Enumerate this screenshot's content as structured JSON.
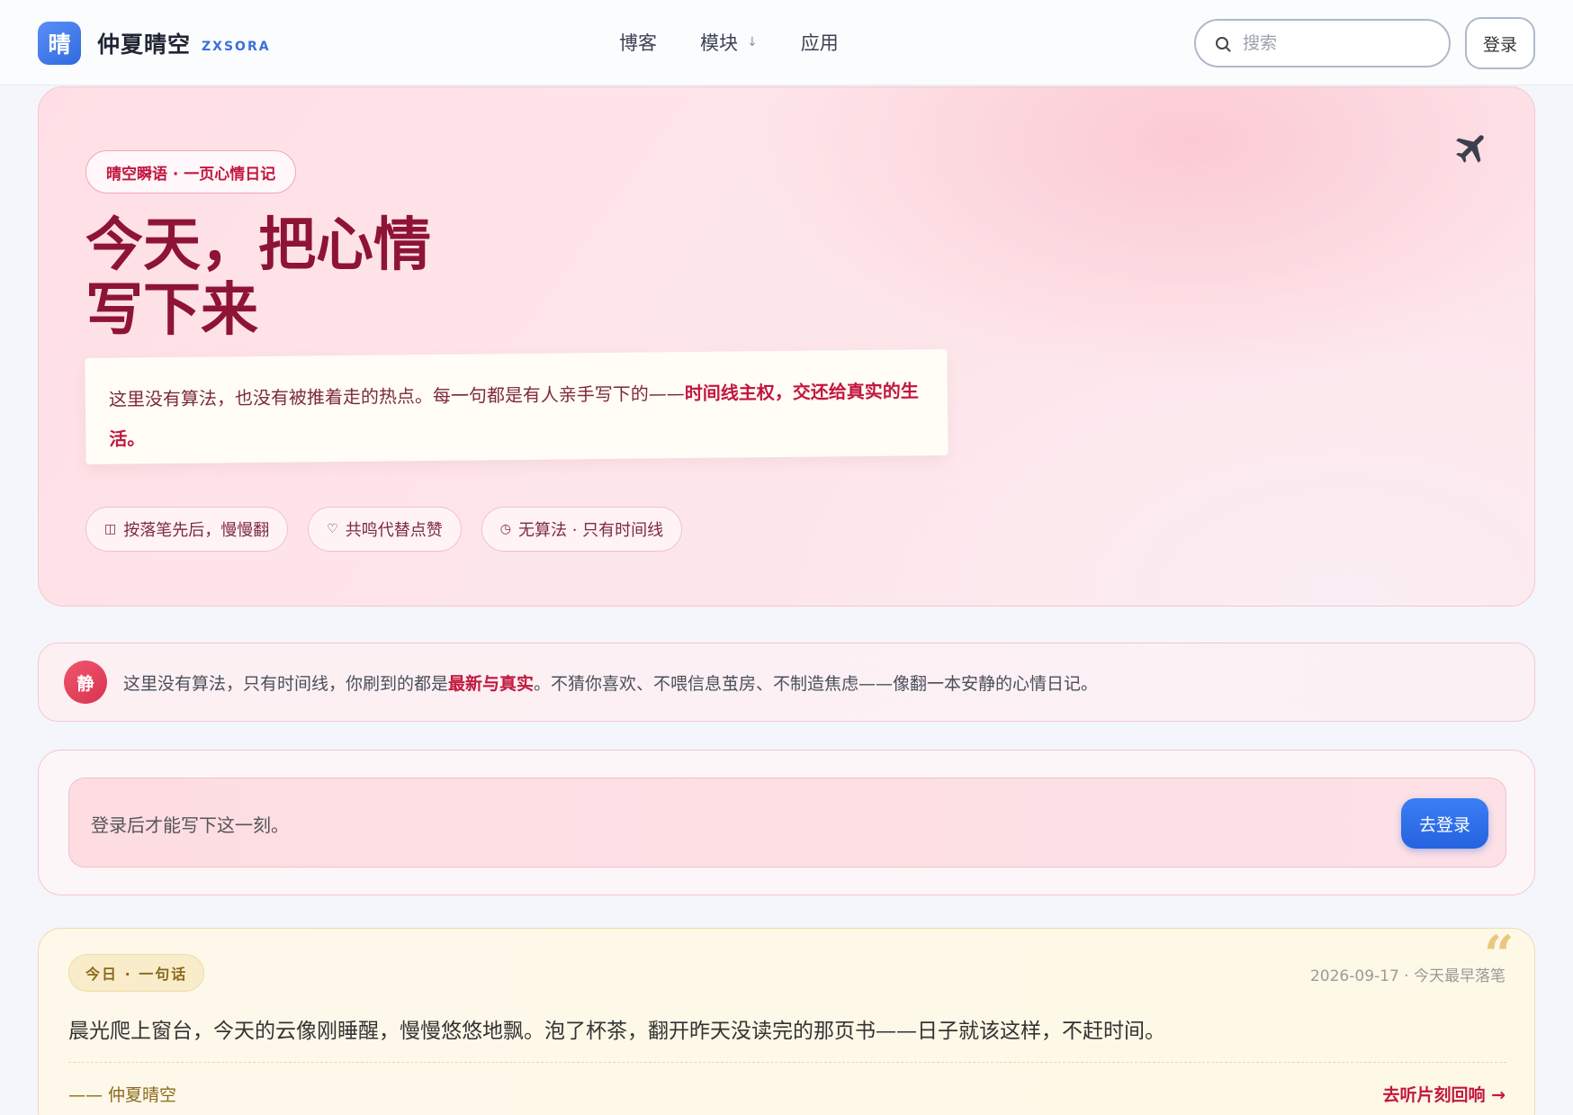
{
  "header": {
    "logo_char": "晴",
    "brand_name": "仲夏晴空",
    "brand_sub": "ZXSORA",
    "nav": [
      {
        "label": "博客"
      },
      {
        "label": "模块",
        "arrow": "↓"
      },
      {
        "label": "应用"
      }
    ],
    "search_placeholder": "搜索",
    "login_label": "登录"
  },
  "hero": {
    "badge": "晴空瞬语 · 一页心情日记",
    "title_line1": "今天，把心情",
    "title_line2": "写下来",
    "quote_plain": "这里没有算法，也没有被推着走的热点。每一句都是有人亲手写下的——",
    "quote_bold": "时间线主权，交还给真实的生活。",
    "chips": [
      {
        "icon": "book-icon",
        "glyph": "◫",
        "label": "按落笔先后，慢慢翻"
      },
      {
        "icon": "heart-icon",
        "glyph": "♡",
        "label": "共鸣代替点赞"
      },
      {
        "icon": "clock-icon",
        "glyph": "◷",
        "label": "无算法 · 只有时间线"
      }
    ],
    "plane_icon": "airplane-icon"
  },
  "notice": {
    "avatar_char": "静",
    "text_before": "这里没有算法，只有时间线，你刷到的都是",
    "text_bold": "最新与真实",
    "text_after": "。不猜你喜欢、不喂信息茧房、不制造焦虑——像翻一本安静的心情日记。"
  },
  "compose": {
    "prompt": "登录后才能写下这一刻。",
    "button": "去登录"
  },
  "daily": {
    "badge": "今日 · 一句话",
    "meta": "2026-09-17 · 今天最早落笔",
    "text": "晨光爬上窗台，今天的云像刚睡醒，慢慢悠悠地飘。泡了杯茶，翻开昨天没读完的那页书——日子就该这样，不赶时间。",
    "author": "—— 仲夏晴空",
    "link": "去听片刻回响 →"
  },
  "colors": {
    "accent": "#c2173e",
    "brand_blue": "#2f6be0",
    "hero_title": "#8e1435",
    "gold": "#8a6a1a"
  }
}
